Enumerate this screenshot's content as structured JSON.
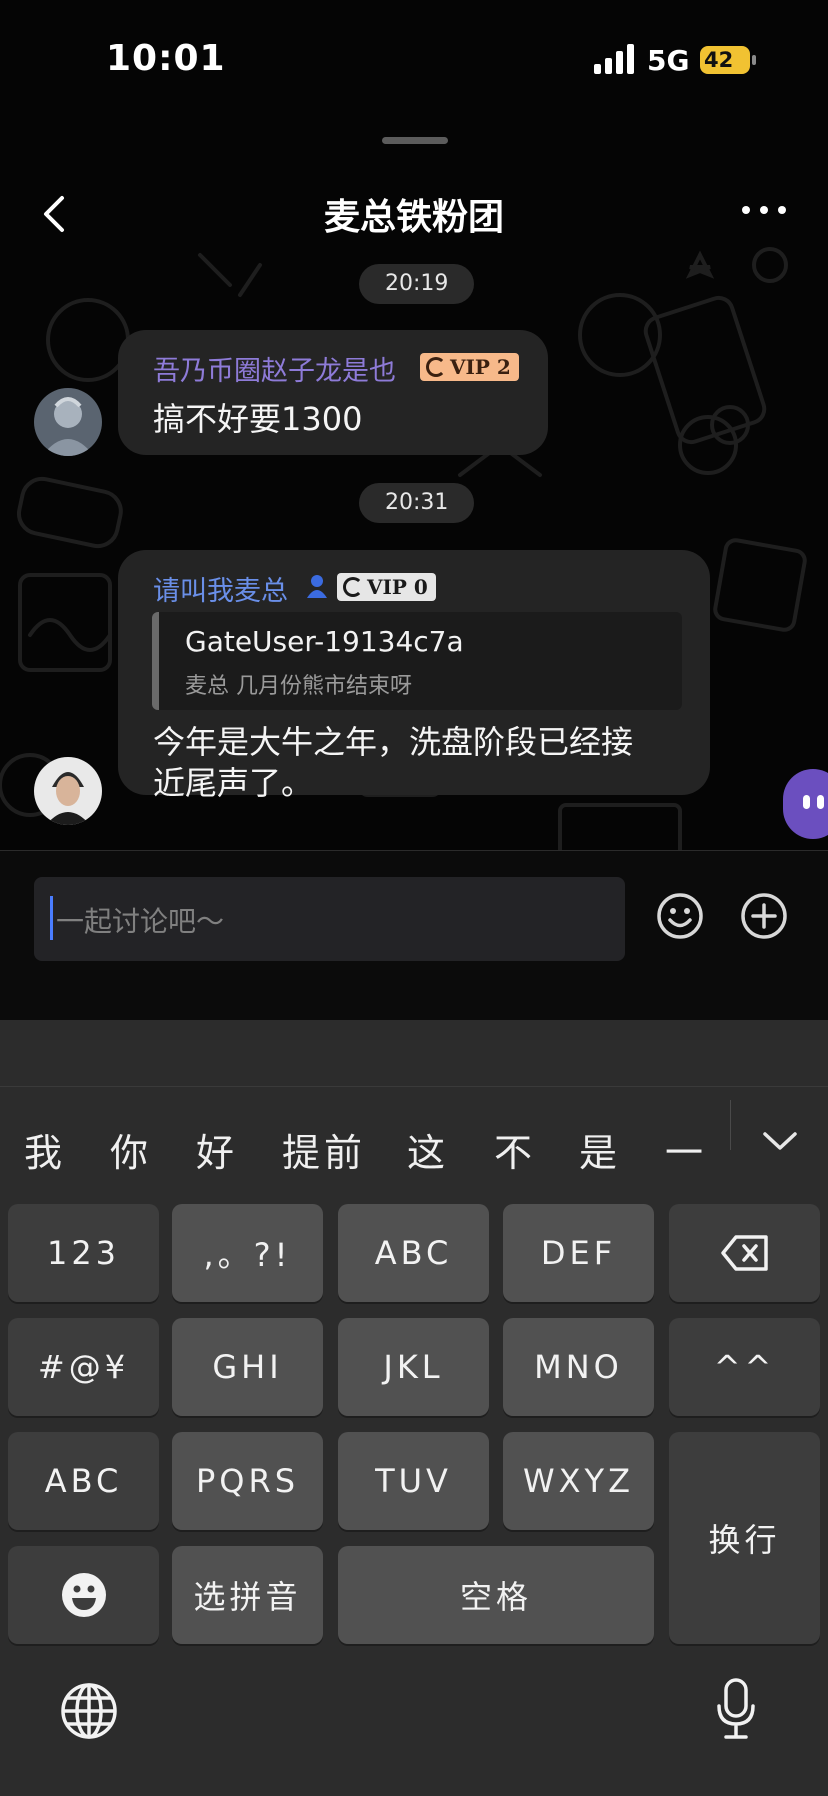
{
  "status_bar": {
    "time": "10:01",
    "network": "5G",
    "battery": "42"
  },
  "header": {
    "title": "麦总铁粉团"
  },
  "chat": {
    "messages": [
      {
        "time": "20:19",
        "sender": "吾乃币圈赵子龙是也",
        "vip": "VIP 2",
        "text": "搞不好要1300"
      },
      {
        "time": "20:31",
        "sender": "请叫我麦总",
        "vip": "VIP 0",
        "quote_user": "GateUser-19134c7a",
        "quote_text": "麦总 几月份熊市结束呀",
        "text_line1": "今年是大牛之年，洗盘阶段已经接",
        "text_line2": "近尾声了。"
      }
    ]
  },
  "composer": {
    "placeholder": "一起讨论吧～"
  },
  "keyboard": {
    "candidates": [
      "我",
      "你",
      "好",
      "提前",
      "这",
      "不",
      "是",
      "一"
    ],
    "rows": [
      [
        "123",
        ",。?!",
        "ABC",
        "DEF"
      ],
      [
        "#@¥",
        "GHI",
        "JKL",
        "MNO",
        "^^"
      ],
      [
        "ABC",
        "PQRS",
        "TUV",
        "WXYZ"
      ],
      [
        "选拼音",
        "空格"
      ]
    ],
    "enter": "换行"
  },
  "colors": {
    "sender1": "#8e7bd8",
    "sender2": "#6a8fe8",
    "vip2_bg": "#f7b98a",
    "vip0_bg": "#e6e6e6",
    "bubble": "#242424",
    "accent": "#4a7dff"
  },
  "icons": [
    "signal-icon",
    "battery-icon",
    "back-icon",
    "more-icon",
    "smiley-icon",
    "plus-icon",
    "delete-icon",
    "emoji-face-icon",
    "globe-icon",
    "mic-icon",
    "chevron-down-icon"
  ]
}
